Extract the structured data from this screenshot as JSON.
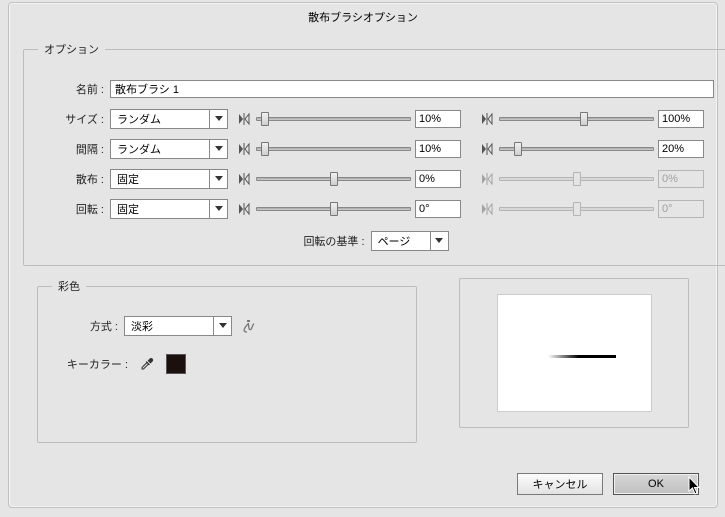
{
  "title": "散布ブラシオプション",
  "options": {
    "legend": "オプション",
    "name_label": "名前 :",
    "name_value": "散布ブラシ 1",
    "rows": [
      {
        "label": "サイズ :",
        "mode": "ランダム",
        "slider1_pct": 6,
        "value1": "10%",
        "slider2_pct": 55,
        "value2": "100%",
        "row2_disabled": false
      },
      {
        "label": "間隔 :",
        "mode": "ランダム",
        "slider1_pct": 6,
        "value1": "10%",
        "slider2_pct": 12,
        "value2": "20%",
        "row2_disabled": false
      },
      {
        "label": "散布 :",
        "mode": "固定",
        "slider1_pct": 50,
        "value1": "0%",
        "slider2_pct": 50,
        "value2": "0%",
        "row2_disabled": true
      },
      {
        "label": "回転 :",
        "mode": "固定",
        "slider1_pct": 50,
        "value1": "0°",
        "slider2_pct": 50,
        "value2": "0°",
        "row2_disabled": true
      }
    ],
    "rotation_basis_label": "回転の基準 :",
    "rotation_basis_value": "ページ"
  },
  "tint": {
    "legend": "彩色",
    "method_label": "方式 :",
    "method_value": "淡彩",
    "key_color_label": "キーカラー :",
    "key_color_hex": "#1b100d"
  },
  "buttons": {
    "cancel": "キャンセル",
    "ok": "OK"
  }
}
